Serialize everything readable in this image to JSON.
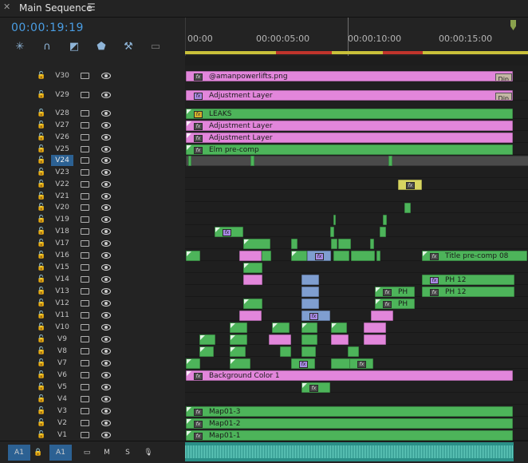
{
  "panel": {
    "title": "Main Sequence",
    "menu_icon": "hamburger-icon"
  },
  "timecode": "00:00:19:19",
  "ruler": {
    "labels": [
      "00:00",
      "00:00:05:00",
      "00:00:10:00",
      "00:00:15:00"
    ]
  },
  "tracks": [
    "V30",
    "V29",
    "V28",
    "V27",
    "V26",
    "V25",
    "V24",
    "V23",
    "V22",
    "V21",
    "V20",
    "V19",
    "V18",
    "V17",
    "V16",
    "V15",
    "V14",
    "V13",
    "V12",
    "V11",
    "V10",
    "V9",
    "V8",
    "V7",
    "V6",
    "V5",
    "V4",
    "V3",
    "V2",
    "V1"
  ],
  "selected_track": "V24",
  "clip_labels": {
    "powerlifts": "@amanpowerlifts.png",
    "adj1": "Adjustment Layer",
    "leaks": "LEAKS",
    "adj2": "Adjustment Layer",
    "adj3": "Adjustment Layer",
    "elm": "Elm pre-comp",
    "title08": "Title pre-comp 08",
    "ph12a": "PH 12",
    "ph12b": "PH 12",
    "ph1": "PH",
    "ph2": "PH",
    "bg": "Background Color 1",
    "map3": "Map01-3",
    "map2": "Map01-2",
    "map1": "Map01-1",
    "dip1": "Dip",
    "dip2": "Dip",
    "fx": "fx"
  },
  "audio": {
    "track": "A1",
    "source": "A1",
    "mute": "M",
    "solo": "S"
  }
}
